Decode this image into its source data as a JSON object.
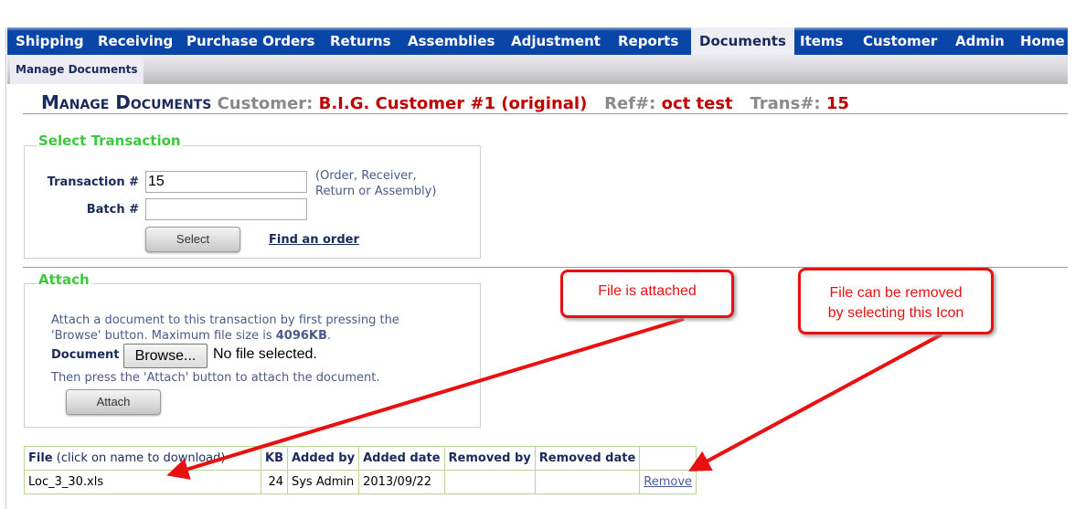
{
  "nav": {
    "items": [
      "Shipping",
      "Receiving",
      "Purchase Orders",
      "Returns",
      "Assemblies",
      "Adjustment",
      "Reports",
      "Documents",
      "Items",
      "Customer",
      "Admin",
      "Home"
    ],
    "active": "Documents"
  },
  "subnav": {
    "item": "Manage Documents"
  },
  "header": {
    "title": "Manage Documents",
    "customer_label": "Customer:",
    "customer": "B.I.G. Customer #1 (original)",
    "ref_label": "Ref#:",
    "ref": "oct test",
    "trans_label": "Trans#:",
    "trans": "15"
  },
  "select": {
    "legend": "Select Transaction",
    "transaction_label": "Transaction #",
    "transaction_value": "15",
    "batch_label": "Batch #",
    "batch_value": "",
    "hint1": "(Order, Receiver,",
    "hint2": "Return or Assembly)",
    "select_button": "Select",
    "find_link": "Find an order"
  },
  "attach": {
    "legend": "Attach",
    "text1": "Attach a document to this transaction by first pressing the",
    "text2a": "'Browse' button. Maximum file size is ",
    "text2b": "4096KB",
    "text2c": ".",
    "document_label": "Document",
    "browse_button": "Browse...",
    "no_file": "No file selected.",
    "text3": "Then press the 'Attach' button to attach the document.",
    "attach_button": "Attach"
  },
  "table": {
    "headers": {
      "file": "File",
      "file_note": " (click on name to download)",
      "kb": "KB",
      "added_by": "Added by",
      "added_date": "Added date",
      "removed_by": "Removed by",
      "removed_date": "Removed date"
    },
    "rows": [
      {
        "file": "Loc_3_30.xls",
        "kb": "24",
        "added_by": "Sys Admin",
        "added_date": "2013/09/22",
        "removed_by": "",
        "removed_date": "",
        "action": "Remove"
      }
    ]
  },
  "annotations": {
    "callout1": "File is attached",
    "callout2a": "File can be removed",
    "callout2b": "by selecting this Icon",
    "color": "#e81010"
  }
}
